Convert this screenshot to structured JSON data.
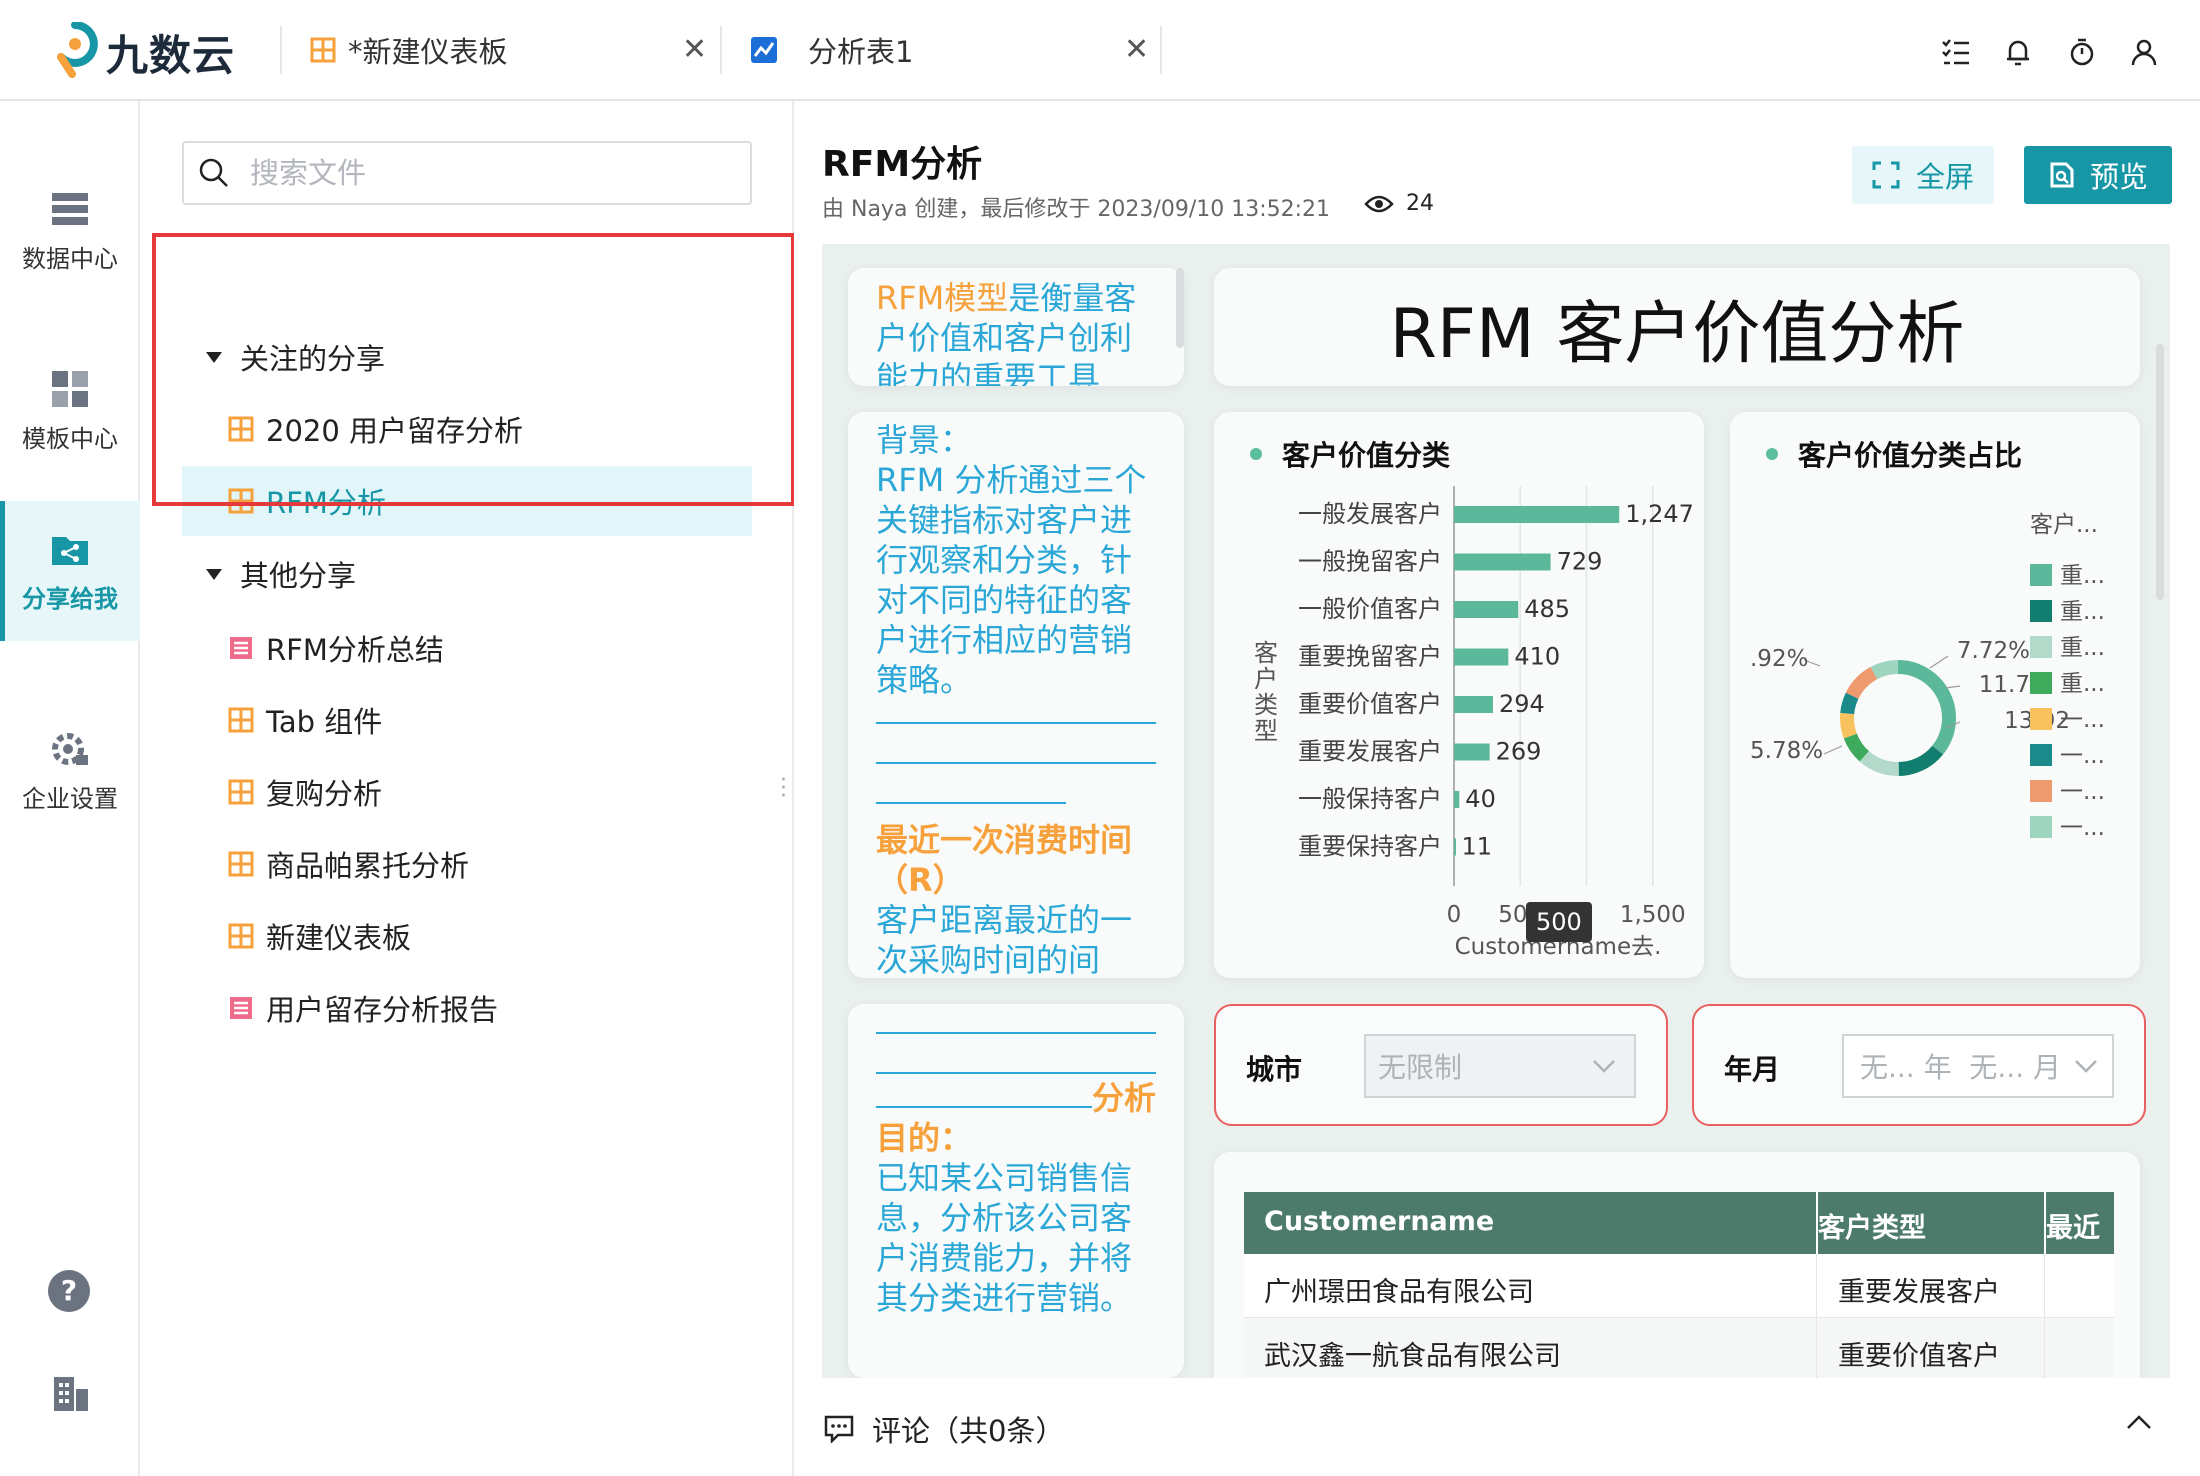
{
  "app": {
    "logo": "九数云"
  },
  "tabs": [
    {
      "label": "*新建仪表板"
    },
    {
      "label": "分析表1"
    }
  ],
  "nav": [
    {
      "label": "数据中心"
    },
    {
      "label": "模板中心"
    },
    {
      "label": "分享给我"
    },
    {
      "label": "企业设置"
    }
  ],
  "search": {
    "placeholder": "搜索文件"
  },
  "tree": {
    "group1": "关注的分享",
    "group1_items": [
      "2020 用户留存分析",
      "RFM分析"
    ],
    "group2": "其他分享",
    "group2_items": [
      "RFM分析总结",
      "Tab 组件",
      "复购分析",
      "商品帕累托分析",
      "新建仪表板",
      "用户留存分析报告"
    ]
  },
  "page": {
    "title": "RFM分析",
    "meta": "由 Naya 创建，最后修改于 2023/09/10 13:52:21",
    "views": "24",
    "fullscreen": "全屏",
    "preview": "预览"
  },
  "dashboard": {
    "intro_highlight": "RFM模型",
    "intro_rest": "是衡量客户价值和客户创利能力的重要工具",
    "bg_title": "背景：",
    "bg_body": "RFM 分析通过三个关键指标对客户进行观察和分类，针对不同的特征的客户进行相应的营销策略。",
    "recency_title": "最近一次消费时间（R）",
    "recency_body": "客户距离最近的一次采购时间的间隔，时间间隔越短",
    "analysis_label": "分析",
    "purpose_title": "目的：",
    "purpose_body": "已知某公司销售信息，分析该公司客户消费能力，并将其分类进行营销。",
    "big_title": "RFM 客户价值分析",
    "bar_title": "客户价值分类",
    "bar_ylabel": "客户类型",
    "bar_xlabel": "Customername去.",
    "tooltip": "500",
    "pie_title": "客户价值分类占比",
    "pie_legend_title": "客户...",
    "filter_city_label": "城市",
    "filter_city_value": "无限制",
    "filter_month_label": "年月",
    "filter_month_value": "无... 年  无... 月",
    "table_headers": [
      "Customername",
      "客户类型",
      "最近"
    ],
    "table_rows": [
      [
        "广州璟田食品有限公司",
        "重要发展客户"
      ],
      [
        "武汉鑫一航食品有限公司",
        "重要价值客户"
      ]
    ]
  },
  "chart_data": [
    {
      "type": "bar",
      "title": "客户价值分类",
      "categories": [
        "一般发展客户",
        "一般挽留客户",
        "一般价值客户",
        "重要挽留客户",
        "重要价值客户",
        "重要发展客户",
        "一般保持客户",
        "重要保持客户"
      ],
      "values": [
        1247,
        729,
        485,
        410,
        294,
        269,
        40,
        11
      ],
      "value_labels": [
        "1,247",
        "729",
        "485",
        "410",
        "294",
        "269",
        "40",
        "11"
      ],
      "xticks": [
        "0",
        "500",
        "1,500"
      ],
      "xlim": [
        0,
        1600
      ],
      "ylabel": "客户类型",
      "xlabel": "Customername去.",
      "color": "#5cb89b"
    },
    {
      "type": "pie",
      "title": "客户价值分类占比",
      "legend_title": "客户...",
      "labels": [
        ".92%",
        "7.72%",
        "11.7",
        "13.92",
        "5.78%"
      ],
      "legend": [
        "重...",
        "重...",
        "重...",
        "重...",
        "一...",
        "一...",
        "一...",
        "一..."
      ],
      "values": [
        35.78,
        13.92,
        11.7,
        7.72,
        7.2,
        5.78,
        9.92,
        7.98
      ],
      "colors": [
        "#5cb89b",
        "#127e6f",
        "#b3d9cb",
        "#3daa5c",
        "#f8c35e",
        "#1a8a8a",
        "#ef9a6e",
        "#9fd4bf"
      ]
    }
  ],
  "comments": {
    "label": "评论（共0条）"
  }
}
